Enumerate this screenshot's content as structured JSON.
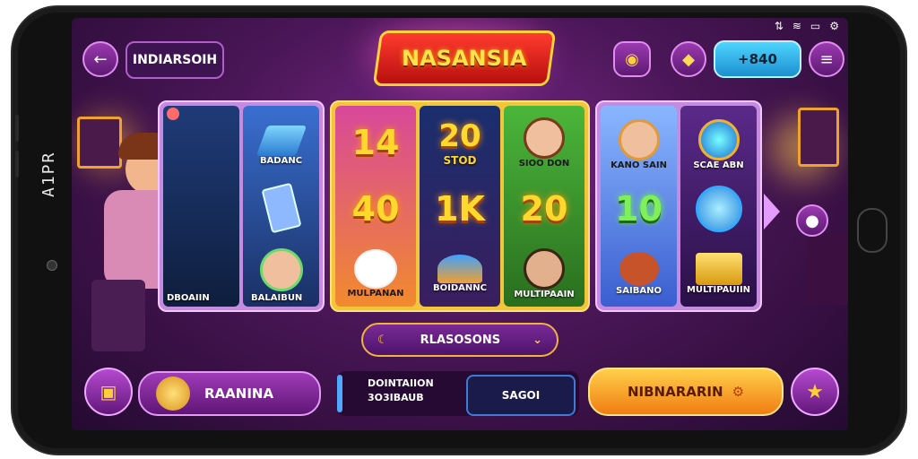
{
  "device": {
    "side_label": "A1PR"
  },
  "header": {
    "back_icon": "arrow-left-icon",
    "player_name": "INDIARSOIH",
    "logo_text": "NASANSIA",
    "coins_icon": "coins-icon",
    "gem_icon": "diamond-icon",
    "credit_value": "+840",
    "menu_icon": "hamburger-menu-icon"
  },
  "reels": {
    "left": {
      "top_label": "BADANC",
      "bottom_left_label": "DBOAIIN",
      "bottom_right_label": "BALAIBUN"
    },
    "middle": {
      "n1": "14",
      "n2": "20",
      "n2_sub": "STOD",
      "n3": "40",
      "n4": "1K",
      "n5": "20",
      "top_right_label": "SIOO DON",
      "bottom_left_label": "MULPANAN",
      "bottom_mid_label": "BOIDANNC",
      "bottom_right_label": "MULTIPAAIN"
    },
    "right": {
      "top_left_label": "KANO SAIN",
      "top_right_label": "SCAE ABN",
      "mid_num": "10",
      "bottom_left_label": "SAIBANO",
      "bottom_right_label": "MULTIPAUIIN"
    }
  },
  "dropdown": {
    "label": "RLASOSONS"
  },
  "bottom_bar": {
    "bet_label": "RAANINA",
    "info_line1": "DOINTAIION",
    "info_line2": "3O3IBAUB",
    "info_value": "SAGOI",
    "spin_label": "NIBNARARIN"
  },
  "colors": {
    "accent_gold": "#ffd82e",
    "accent_purple": "#7b2a8a",
    "credit_blue": "#4fd5ff",
    "spin_orange": "#f07d12"
  }
}
